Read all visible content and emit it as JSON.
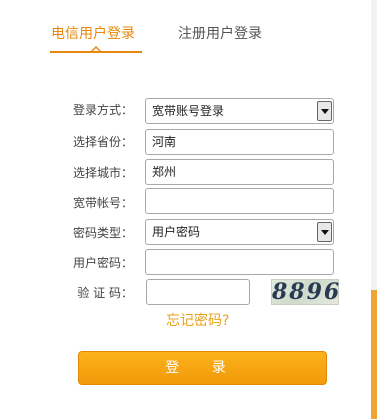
{
  "tabs": {
    "telecom_login": "电信用户登录",
    "registered_login": "注册用户登录"
  },
  "form": {
    "login_method": {
      "label": "登录方式：",
      "value": "宽带账号登录"
    },
    "province": {
      "label": "选择省份：",
      "value": "河南"
    },
    "city": {
      "label": "选择城市：",
      "value": "郑州"
    },
    "broadband_account": {
      "label": "宽带帐号：",
      "value": ""
    },
    "password_type": {
      "label": "密码类型：",
      "value": "用户密码"
    },
    "user_password": {
      "label": "用户密码：",
      "value": ""
    },
    "captcha": {
      "label": "验 证 码：",
      "value": "",
      "image_text": "8896"
    }
  },
  "forgot_password": "忘记密码?",
  "login_button": "登 录",
  "colors": {
    "accent": "#e8870e",
    "button": "#f9a614",
    "link": "#e8a21c"
  }
}
